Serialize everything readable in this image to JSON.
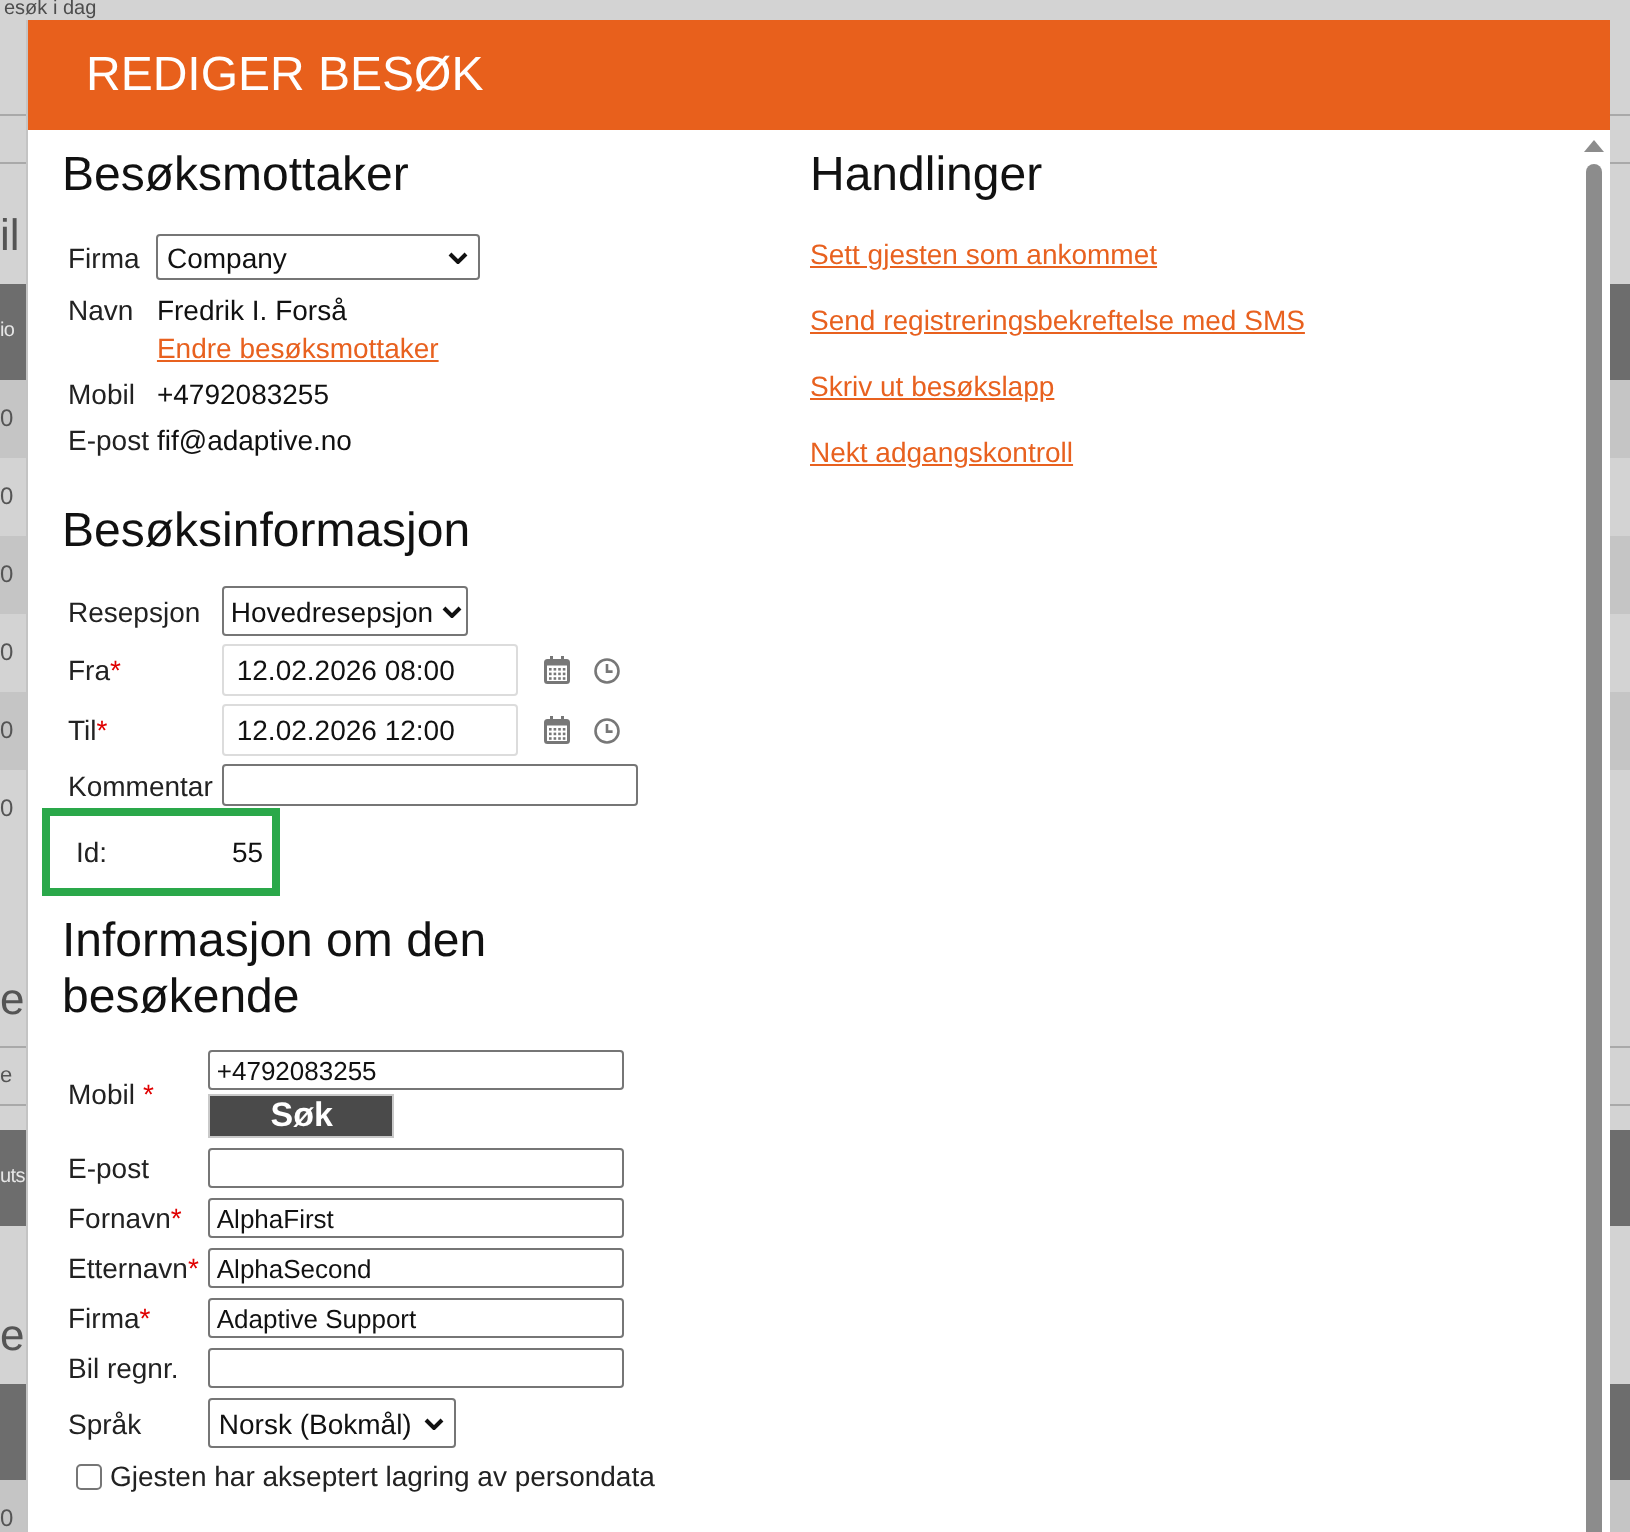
{
  "background_page": {
    "heading": "esøk i dag",
    "left_edge": [
      {
        "kind": "heading",
        "text": "il"
      },
      {
        "kind": "header",
        "text": "io"
      },
      {
        "kind": "row",
        "text": "0"
      },
      {
        "kind": "row",
        "text": "0"
      },
      {
        "kind": "row",
        "text": "0"
      },
      {
        "kind": "row",
        "text": "0"
      },
      {
        "kind": "row",
        "text": "0"
      },
      {
        "kind": "row",
        "text": "0"
      },
      {
        "kind": "heading",
        "text": "e"
      },
      {
        "kind": "field",
        "text": "e"
      },
      {
        "kind": "header",
        "text": "uts"
      },
      {
        "kind": "heading",
        "text": "e"
      },
      {
        "kind": "header"
      },
      {
        "kind": "row",
        "text": "0"
      }
    ]
  },
  "dialog": {
    "title": "REDIGER BESØK",
    "recipient": {
      "heading": "Besøksmottaker",
      "company": {
        "label": "Firma",
        "value": "Company"
      },
      "name": {
        "label": "Navn",
        "value": "Fredrik I. Forså",
        "link": "Endre besøksmottaker"
      },
      "mobile": {
        "label": "Mobil",
        "value": "+4792083255"
      },
      "email": {
        "label": "E-post",
        "value": "fif@adaptive.no"
      }
    },
    "actions": {
      "heading": "Handlinger",
      "links": [
        "Sett gjesten som ankommet",
        "Send registreringsbekreftelse med SMS",
        "Skriv ut besøkslapp",
        "Nekt adgangskontroll"
      ]
    },
    "visit_info": {
      "heading": "Besøksinformasjon",
      "reception": {
        "label": "Resepsjon",
        "value": "Hovedresepsjon"
      },
      "from": {
        "label": "Fra",
        "mark": "*",
        "value": "12.02.2026 08:00"
      },
      "to": {
        "label": "Til",
        "mark": "*",
        "value": "12.02.2026 12:00"
      },
      "comment": {
        "label": "Kommentar"
      },
      "id": {
        "label": "Id:",
        "value": "55",
        "highlighted": true
      }
    },
    "visitor": {
      "heading": "Informasjon om den besøkende",
      "mobile": {
        "label": "Mobil",
        "mark": "*",
        "value": "+4792083255",
        "button": "Søk"
      },
      "fields": [
        {
          "kind": "text",
          "label": "E-post"
        },
        {
          "kind": "text",
          "label": "Fornavn",
          "mark": "*",
          "value": "AlphaFirst"
        },
        {
          "kind": "text",
          "label": "Etternavn",
          "mark": "*",
          "value": "AlphaSecond"
        },
        {
          "kind": "text",
          "label": "Firma",
          "mark": "*",
          "value": "Adaptive Support"
        },
        {
          "kind": "text",
          "label": "Bil regnr."
        },
        {
          "kind": "select",
          "label": "Språk",
          "value": "Norsk (Bokmål)"
        }
      ],
      "consent": {
        "label": "Gjesten har akseptert lagring av persondata",
        "checked": false
      }
    }
  }
}
